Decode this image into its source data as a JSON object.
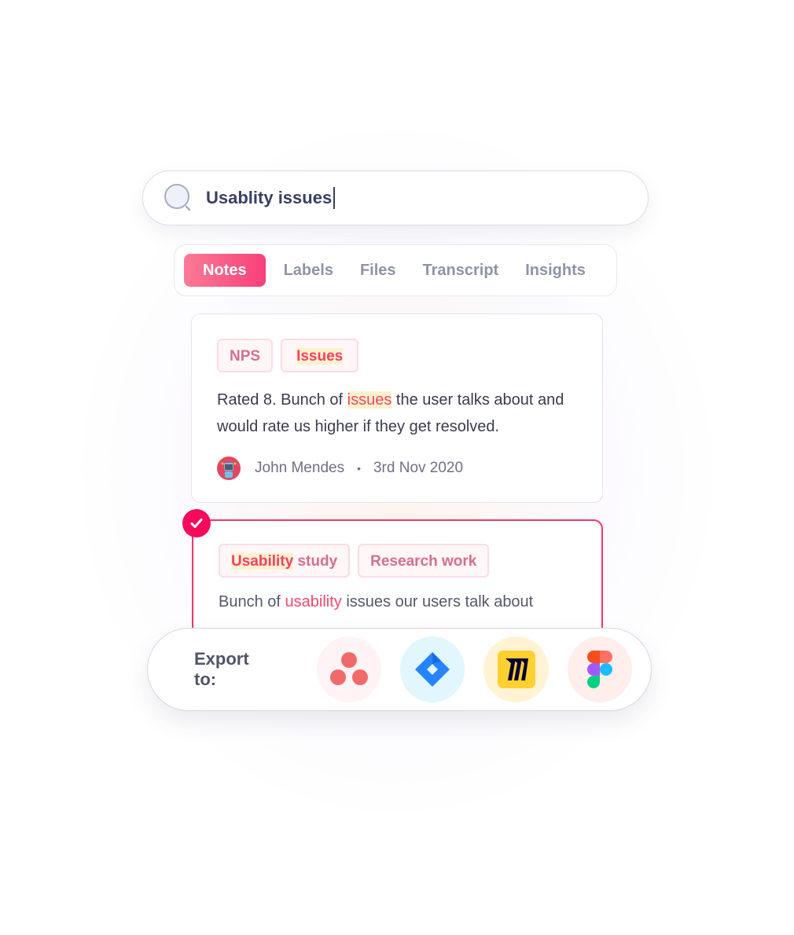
{
  "search": {
    "value": "Usablity issues",
    "icon": "search-icon"
  },
  "tabs": [
    {
      "label": "Notes",
      "active": true
    },
    {
      "label": "Labels"
    },
    {
      "label": "Files"
    },
    {
      "label": "Transcript"
    },
    {
      "label": "Insights"
    }
  ],
  "cards": [
    {
      "tags": [
        "NPS",
        "Issues"
      ],
      "text_before": "Rated 8. Bunch of ",
      "text_highlight": "issues",
      "text_after": " the user talks about and would rate us higher if they get resolved.",
      "author": "John Mendes",
      "separator": "•",
      "date": "3rd Nov 2020",
      "selected": false
    },
    {
      "tag1_highlight": "Usability",
      "tag1_rest": " study",
      "tag2": "Research work",
      "text_before": "Bunch of ",
      "text_highlight": "usability",
      "text_after": " issues our users talk about",
      "selected": true
    }
  ],
  "export": {
    "label": "Export to:",
    "integrations": [
      {
        "name": "Asana",
        "icon": "asana-icon"
      },
      {
        "name": "Jira",
        "icon": "jira-icon"
      },
      {
        "name": "Miro",
        "icon": "miro-icon"
      },
      {
        "name": "Figma",
        "icon": "figma-icon"
      }
    ]
  },
  "colors": {
    "accent": "#f7407a",
    "selected_border": "#f73567",
    "highlight": "#fdf1cc"
  }
}
